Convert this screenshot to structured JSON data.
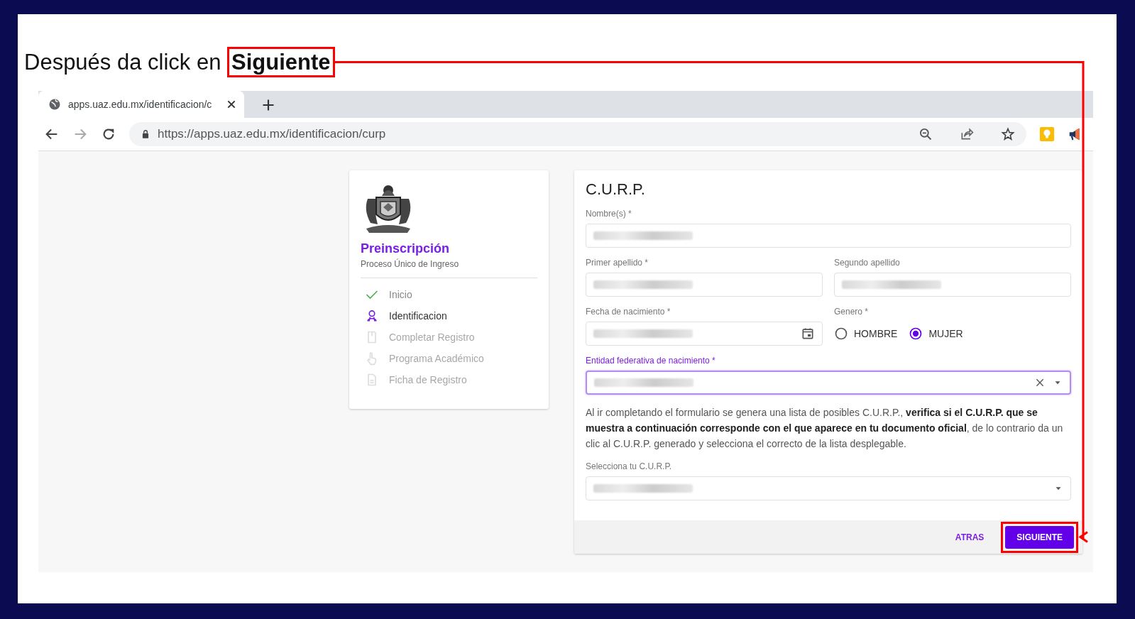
{
  "annotation": {
    "text": "Después da click en **Siguiente**"
  },
  "browser": {
    "tab_title": "apps.uaz.edu.mx/identificacion/c",
    "url": "https://apps.uaz.edu.mx/identificacion/curp"
  },
  "stepper": {
    "title": "Preinscripción",
    "subtitle": "Proceso Único de Ingreso",
    "steps": [
      {
        "label": "Inicio",
        "done": true,
        "current": false
      },
      {
        "label": "Identificacion",
        "done": false,
        "current": true
      },
      {
        "label": "Completar Registro",
        "done": false,
        "current": false
      },
      {
        "label": "Programa Académico",
        "done": false,
        "current": false
      },
      {
        "label": "Ficha de Registro",
        "done": false,
        "current": false
      }
    ]
  },
  "form": {
    "title": "C.U.R.P.",
    "rows": [
      [
        {
          "kind": "text",
          "label": "Nombre(s) *",
          "value_hidden": true,
          "focused": false
        }
      ],
      [
        {
          "kind": "text",
          "label": "Primer apellido *",
          "value_hidden": true,
          "focused": false
        },
        {
          "kind": "text",
          "label": "Segundo apellido",
          "value_hidden": true,
          "focused": false
        }
      ],
      [
        {
          "kind": "date",
          "label": "Fecha de nacimiento *",
          "value_hidden": true,
          "focused": false
        },
        {
          "kind": "radio",
          "label": "Genero *",
          "options": [
            {
              "label": "HOMBRE",
              "selected": false
            },
            {
              "label": "MUJER",
              "selected": true
            }
          ]
        }
      ],
      [
        {
          "kind": "select",
          "label": "Entidad federativa de nacimiento *",
          "value_hidden": true,
          "focused": true,
          "clearable": true
        }
      ]
    ],
    "note": "Al ir completando el formulario se genera una lista de posibles C.U.R.P., **verifica si el C.U.R.P. que se muestra a continuación corresponde con el que aparece en tu documento oficial**, de lo contrario da un clic al C.U.R.P. generado y selecciona el correcto de la lista desplegable.",
    "curp_field": {
      "kind": "select",
      "label": "Selecciona tu C.U.R.P.",
      "value_hidden": true
    },
    "back_button": {
      "label": "ATRAS"
    },
    "next_button": {
      "label": "SIGUIENTE",
      "highlighted": true
    }
  }
}
